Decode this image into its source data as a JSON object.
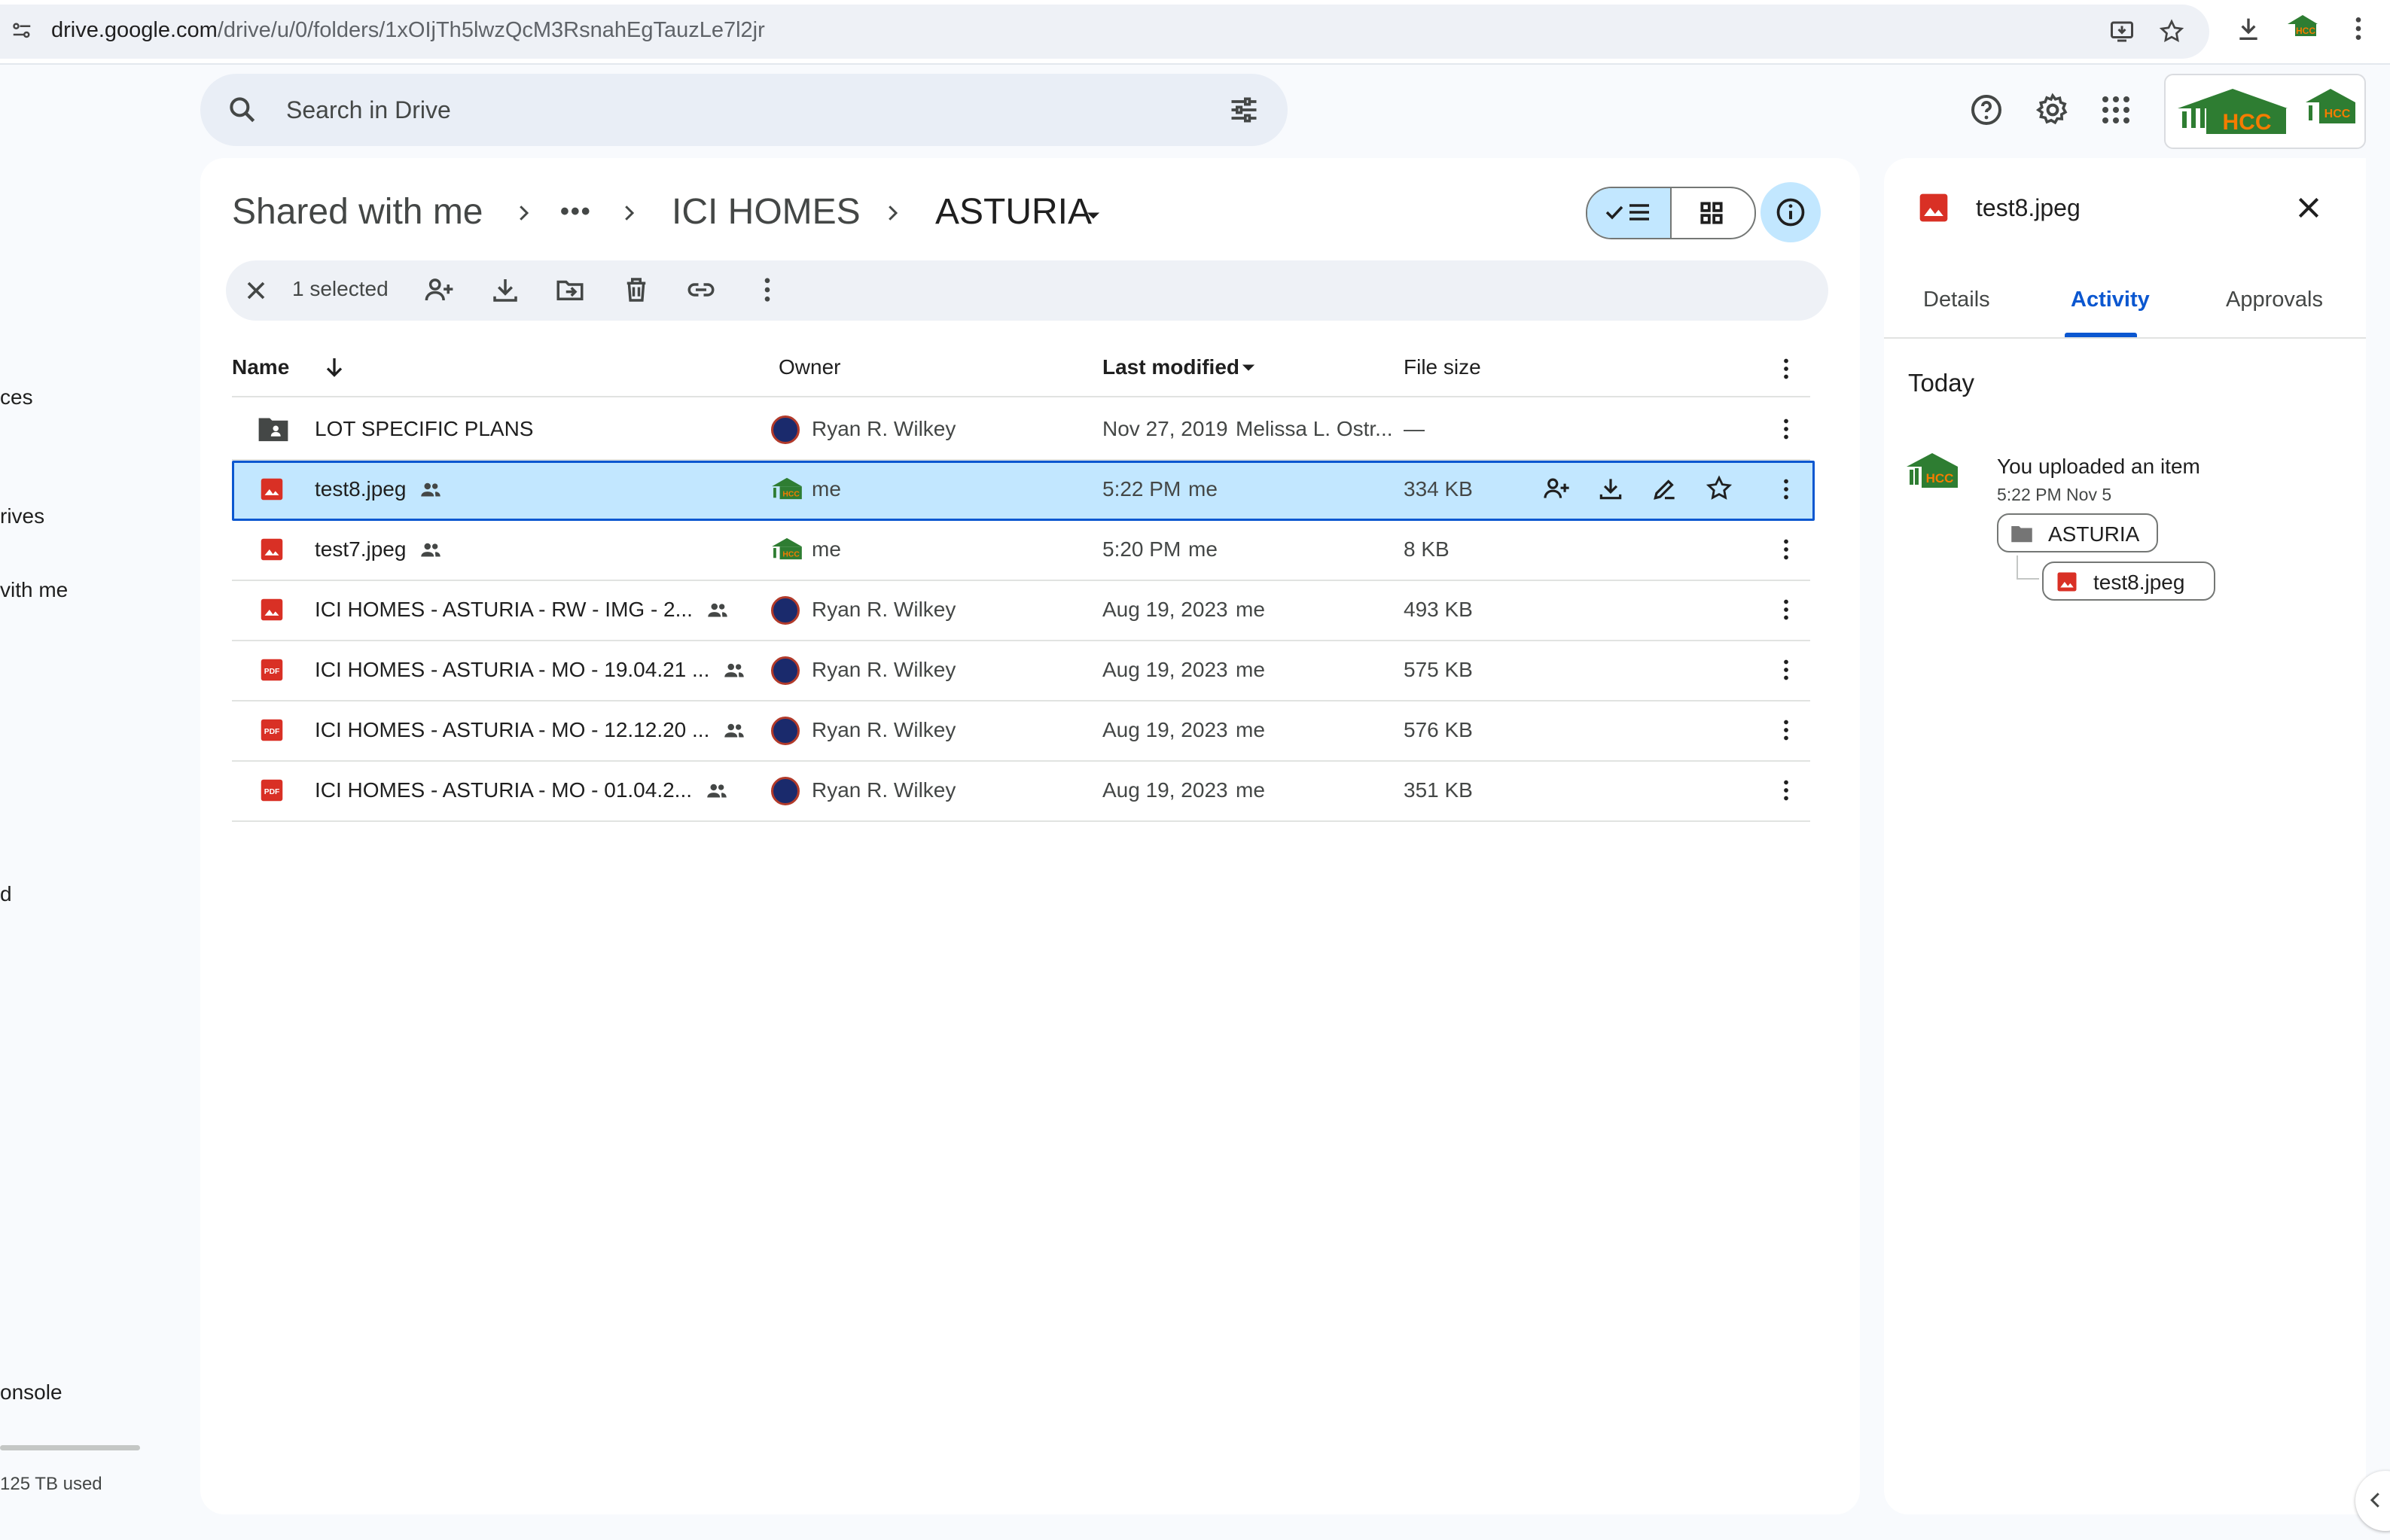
{
  "browser": {
    "url_host": "drive.google.com",
    "url_path": "/drive/u/0/folders/1xOIjTh5lwzQcM3RsnahEgTauzLe7l2jr"
  },
  "sidebar": {
    "partial_labels": [
      "ces",
      "rives",
      "vith me",
      "d",
      "onsole"
    ],
    "storage_text": "125 TB used"
  },
  "search": {
    "placeholder": "Search in Drive"
  },
  "breadcrumb": {
    "root": "Shared with me",
    "ellipsis": "•••",
    "parent": "ICI HOMES",
    "current": "ASTURIA"
  },
  "toolbar": {
    "selected_count": "1 selected"
  },
  "table": {
    "headers": {
      "name": "Name",
      "owner": "Owner",
      "modified": "Last modified",
      "size": "File size"
    },
    "rows": [
      {
        "type": "shared-folder",
        "name": "LOT SPECIFIC PLANS",
        "shared": false,
        "owner": "Ryan R. Wilkey",
        "owner_avatar": "dark-avatar",
        "modified": "Nov 27, 2019",
        "modified_by": "Melissa L. Ostr...",
        "size": "—",
        "selected": false
      },
      {
        "type": "image",
        "name": "test8.jpeg",
        "shared": true,
        "owner": "me",
        "owner_avatar": "hcc-logo",
        "modified": "5:22 PM",
        "modified_by": "me",
        "size": "334 KB",
        "selected": true
      },
      {
        "type": "image",
        "name": "test7.jpeg",
        "shared": true,
        "owner": "me",
        "owner_avatar": "hcc-logo",
        "modified": "5:20 PM",
        "modified_by": "me",
        "size": "8 KB",
        "selected": false
      },
      {
        "type": "image",
        "name": "ICI HOMES - ASTURIA - RW -  IMG  - 2...",
        "shared": true,
        "owner": "Ryan R. Wilkey",
        "owner_avatar": "dark-avatar",
        "modified": "Aug 19, 2023",
        "modified_by": "me",
        "size": "493 KB",
        "selected": false
      },
      {
        "type": "pdf",
        "name": "ICI HOMES - ASTURIA - MO - 19.04.21 ...",
        "shared": true,
        "owner": "Ryan R. Wilkey",
        "owner_avatar": "dark-avatar",
        "modified": "Aug 19, 2023",
        "modified_by": "me",
        "size": "575 KB",
        "selected": false
      },
      {
        "type": "pdf",
        "name": "ICI HOMES - ASTURIA - MO - 12.12.20 ...",
        "shared": true,
        "owner": "Ryan R. Wilkey",
        "owner_avatar": "dark-avatar",
        "modified": "Aug 19, 2023",
        "modified_by": "me",
        "size": "576 KB",
        "selected": false
      },
      {
        "type": "pdf",
        "name": "ICI HOMES - ASTURIA - MO - 01.04.2...",
        "shared": true,
        "owner": "Ryan R. Wilkey",
        "owner_avatar": "dark-avatar",
        "modified": "Aug 19, 2023",
        "modified_by": "me",
        "size": "351 KB",
        "selected": false
      }
    ]
  },
  "details": {
    "file_name": "test8.jpeg",
    "tabs": [
      "Details",
      "Activity",
      "Approvals"
    ],
    "active_tab": "Activity",
    "section": "Today",
    "activity": {
      "text": "You uploaded an item",
      "time": "5:22 PM Nov 5",
      "folder": "ASTURIA",
      "file": "test8.jpeg"
    }
  },
  "account": {
    "logo_text": "HCC"
  },
  "colors": {
    "accent": "#0b57d0",
    "selection": "#c2e7ff",
    "image_icon": "#d93025",
    "logo_green": "#2e7d32",
    "logo_orange": "#f57c00"
  },
  "icons": {
    "address_bar": [
      "site-info-icon",
      "install-app-icon",
      "bookmark-star-icon",
      "downloads-icon",
      "profile-logo",
      "browser-menu-icon"
    ],
    "header": [
      "search-icon",
      "search-options-icon",
      "help-icon",
      "settings-icon",
      "apps-grid-icon"
    ],
    "toolbar": [
      "clear-selection-icon",
      "share-icon",
      "download-icon",
      "move-icon",
      "trash-icon",
      "copy-link-icon",
      "more-actions-icon"
    ]
  }
}
